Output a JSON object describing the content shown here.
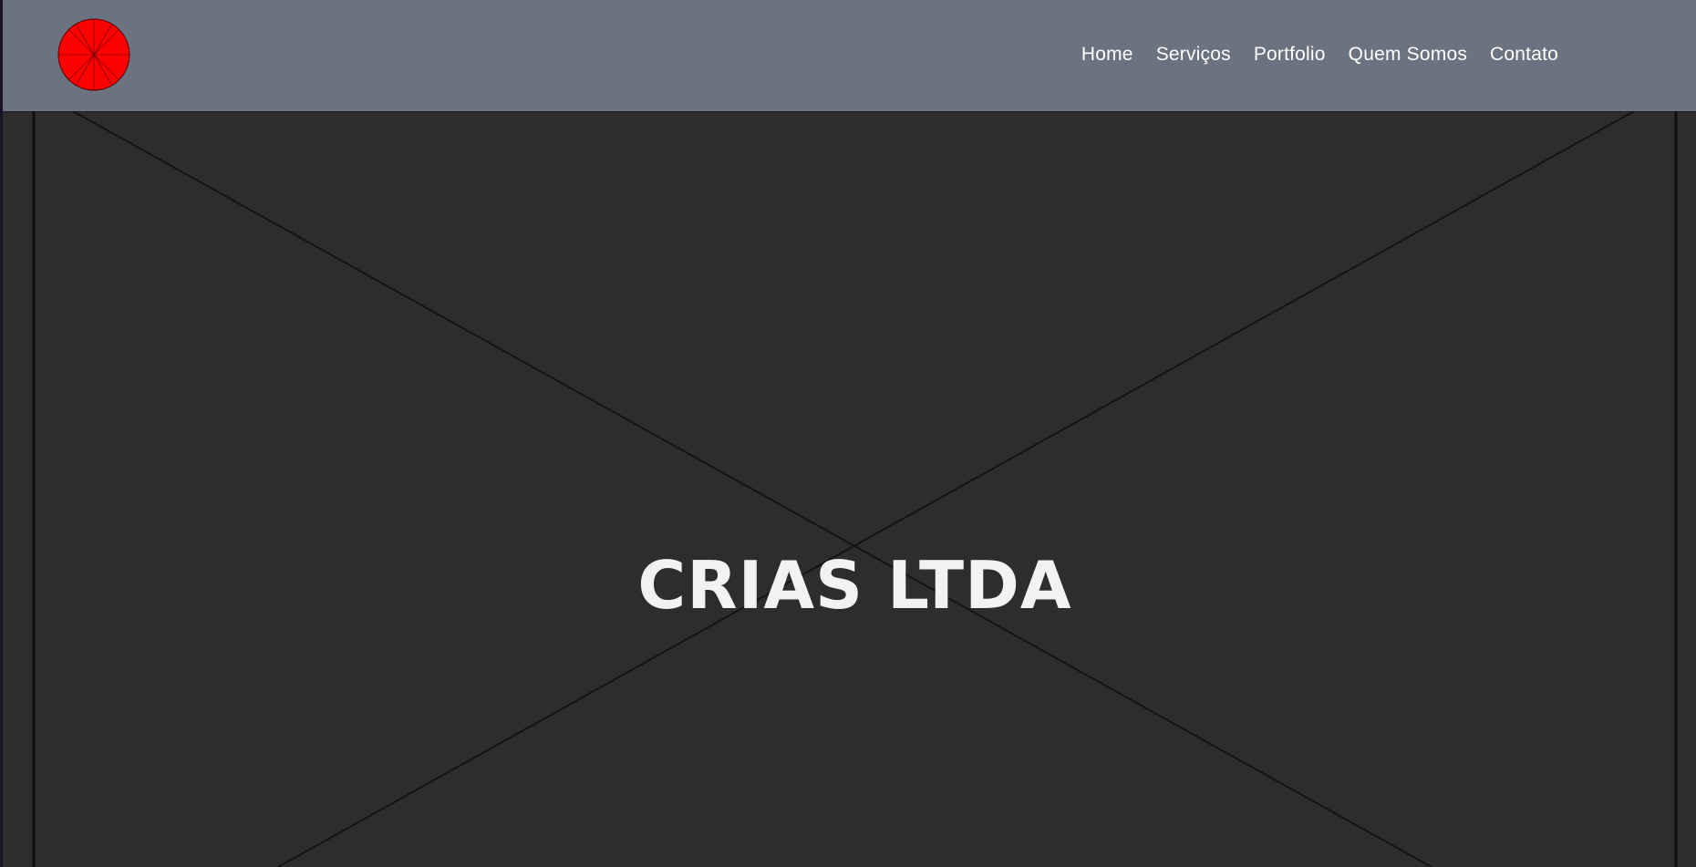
{
  "header": {
    "logo_icon": "red-circle-logo",
    "background": "#6b7280",
    "nav": [
      {
        "label": "Home"
      },
      {
        "label": "Serviços"
      },
      {
        "label": "Portfolio"
      },
      {
        "label": "Quem Somos"
      },
      {
        "label": "Contato"
      }
    ]
  },
  "hero": {
    "title": "CRIAS LTDA",
    "placeholder_icon": "image-placeholder-cross-icon",
    "background": "#2d2d2d"
  },
  "colors": {
    "logo": "#ff0000",
    "text": "#ffffff"
  }
}
